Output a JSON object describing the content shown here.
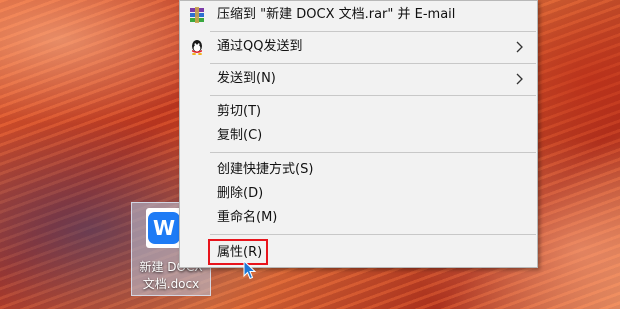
{
  "context_menu": {
    "items": [
      {
        "label": "压缩到 \"新建 DOCX 文档.rar\" 并 E-mail",
        "icon": "winrar-books-icon"
      },
      {
        "label": "通过QQ发送到",
        "icon": "qq-penguin-icon",
        "submenu": true
      },
      {
        "label": "发送到(N)",
        "submenu": true
      },
      {
        "label": "剪切(T)"
      },
      {
        "label": "复制(C)"
      },
      {
        "label": "创建快捷方式(S)"
      },
      {
        "label": "删除(D)"
      },
      {
        "label": "重命名(M)"
      },
      {
        "label": "属性(R)",
        "highlighted": true
      }
    ]
  },
  "desktop_icon": {
    "label_line1": "新建 DOCX",
    "label_line2": "文档.docx",
    "icon": "wps-writer-icon",
    "icon_letter": "W"
  },
  "colors": {
    "menu_bg": "#f2f2f2",
    "highlight_border": "#e8141c",
    "wps_blue": "#1e7bf5",
    "cursor_blue": "#1e78d6"
  }
}
